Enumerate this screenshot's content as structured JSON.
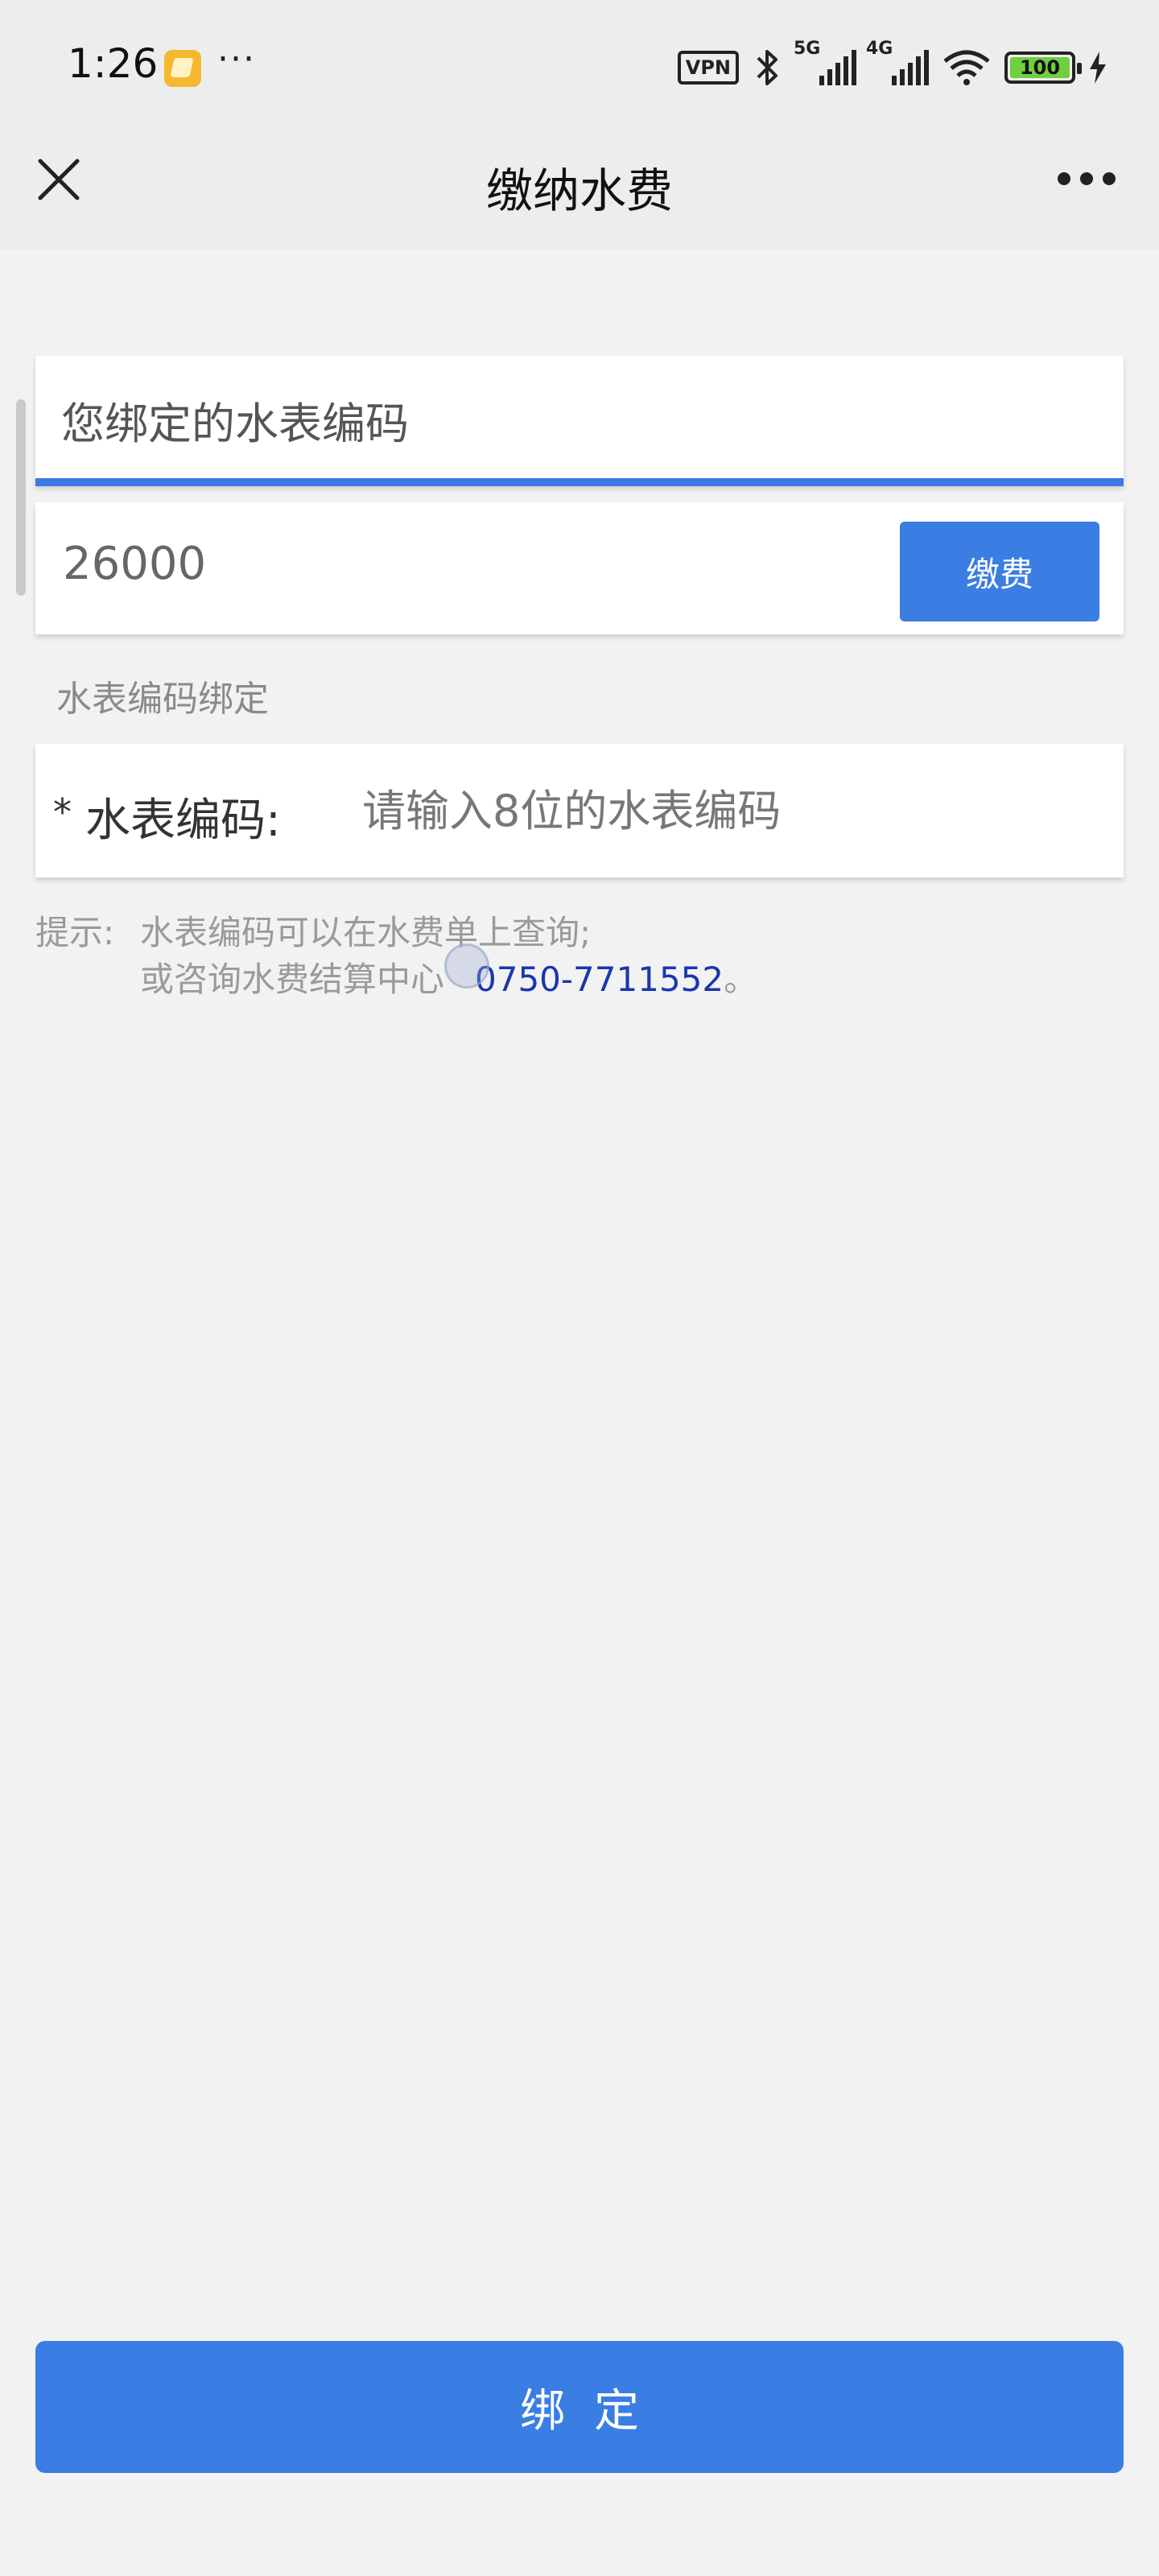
{
  "status_bar": {
    "time": "1:26",
    "dots": "···",
    "vpn_label": "VPN",
    "net1": "5G",
    "net2": "4G",
    "battery": "100"
  },
  "nav": {
    "title": "缴纳水费"
  },
  "meter_card": {
    "title": "您绑定的水表编码"
  },
  "amount_card": {
    "amount": "26000",
    "pay_label": "缴费"
  },
  "bind_section": {
    "label": "水表编码绑定",
    "required_mark": "*",
    "field_label": "水表编码:",
    "placeholder": "请输入8位的水表编码"
  },
  "hint": {
    "prefix": "提示:",
    "line1": "水表编码可以在水费单上查询;",
    "line2": "或咨询水费结算中心",
    "phone": "0750-7711552",
    "line2_end": "。"
  },
  "footer": {
    "bind_label": "绑定"
  },
  "colors": {
    "accent": "#3a7de3",
    "phone_link": "#1a35b0"
  }
}
